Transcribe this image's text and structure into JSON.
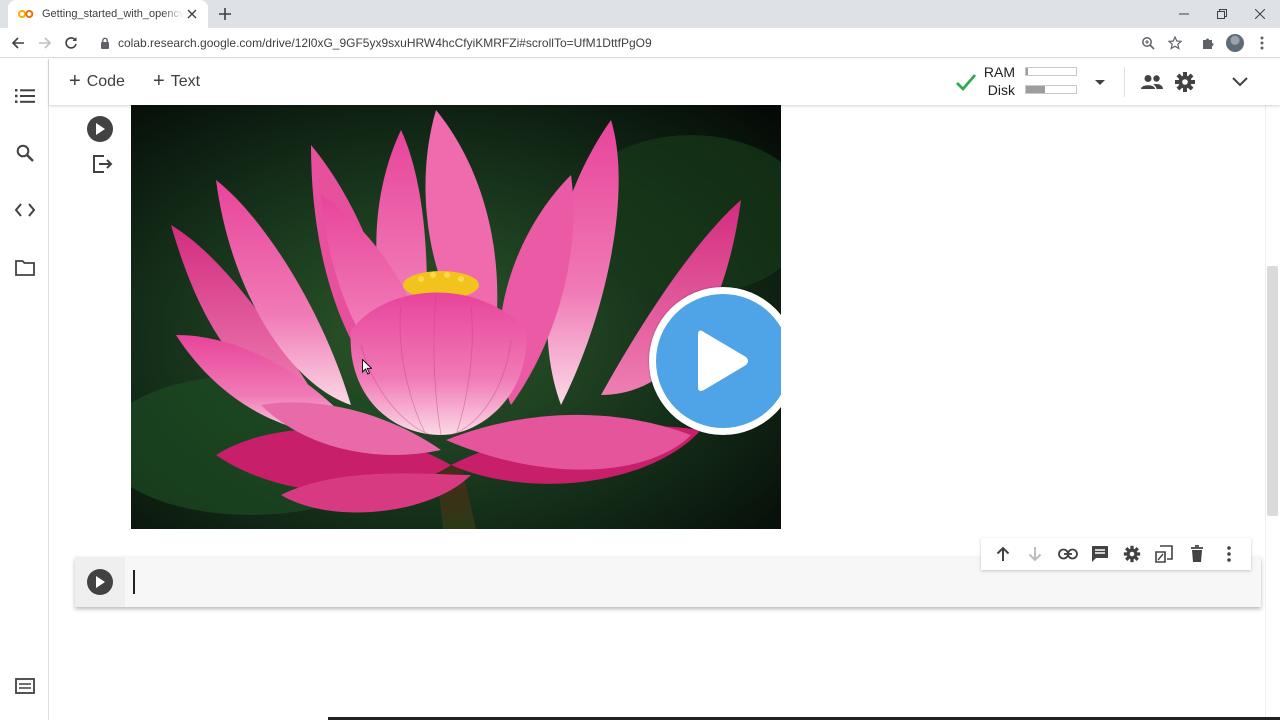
{
  "browser": {
    "tab_title": "Getting_started_with_opencv.ipynb",
    "url": "colab.research.google.com/drive/12l0xG_9GF5yx9sxuHRW4hcCfyiKMRFZi#scrollTo=UfM1DttfPgO9"
  },
  "colab_toolbar": {
    "code_label": "Code",
    "text_label": "Text",
    "ram_label": "RAM",
    "disk_label": "Disk",
    "ram_usage_fraction": 0.04,
    "disk_usage_fraction": 0.38
  },
  "colors": {
    "accent_check": "#34a853",
    "play_overlay": "#4fa4e8",
    "run_button": "#424242"
  },
  "icons": {
    "left_rail": [
      "toc-icon",
      "search-icon",
      "code-snippets-icon",
      "files-icon",
      "terminal-icon"
    ],
    "cell_toolbar": [
      "arrow-up-icon",
      "arrow-down-icon",
      "link-icon",
      "comment-icon",
      "settings-icon",
      "mirror-cell-icon",
      "delete-icon",
      "more-vert-icon"
    ]
  }
}
